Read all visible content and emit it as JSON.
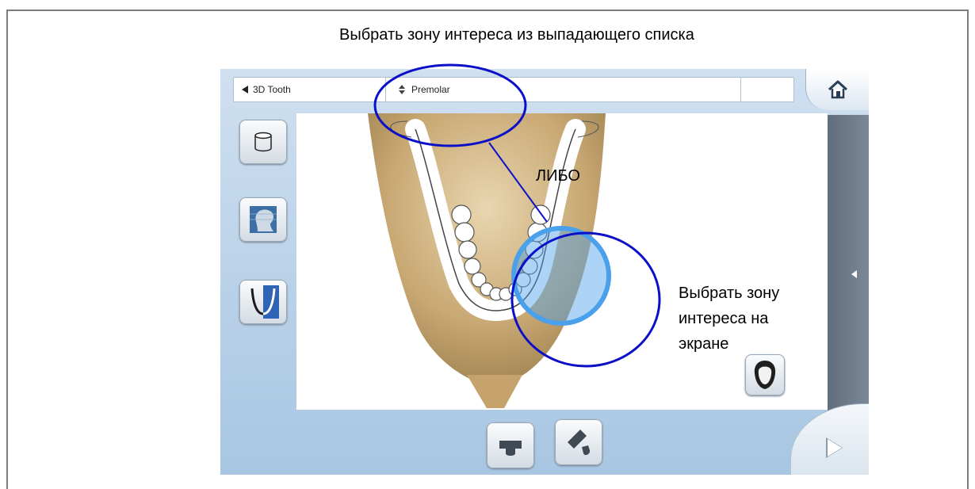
{
  "annotation": {
    "top_caption": "Выбрать зону интереса из выпадающего списка",
    "or_label": "ЛИБО",
    "screen_caption_line1": "Выбрать зону",
    "screen_caption_line2": "интереса на",
    "screen_caption_line3": "экране",
    "circle_color": "#0b10c8",
    "selection_color": "#4aa0ea"
  },
  "toolbar": {
    "back_label": "3D Tooth",
    "region_label": "Premolar",
    "extra_value": ""
  },
  "side_buttons": [
    "cylinder-volume-icon",
    "head-profile-icon",
    "jaw-arch-icon"
  ],
  "bottom_buttons": [
    "bite-block-icon",
    "bite-block-angled-icon"
  ],
  "icons": {
    "home": "home-icon",
    "next": "next-arrow-icon",
    "panel": "panel-toggle-icon",
    "head_front": "head-front-icon"
  }
}
